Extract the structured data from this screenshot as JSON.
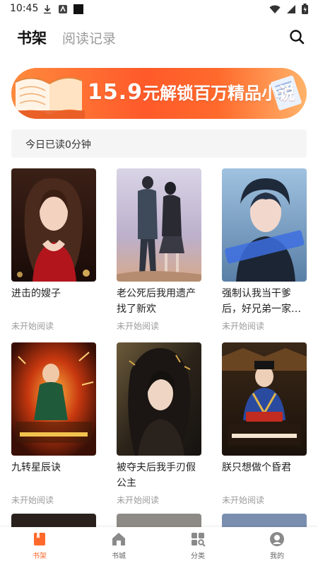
{
  "status_bar": {
    "time": "10:45"
  },
  "header": {
    "tab_active": "书架",
    "tab_inactive": "阅读记录",
    "search_icon": "search-icon"
  },
  "banner": {
    "price": "15.9",
    "text": "元解锁百万精品小说"
  },
  "reading": {
    "text": "今日已读0分钟"
  },
  "books": [
    {
      "title": "进击的嫂子",
      "status": "未开始阅读"
    },
    {
      "title": "老公死后我用遗产找了新欢",
      "status": "未开始阅读"
    },
    {
      "title": "强制认我当干爹后，好兄弟一家…",
      "status": "未开始阅读"
    },
    {
      "title": "九转星辰诀",
      "status": "未开始阅读"
    },
    {
      "title": "被夺夫后我手刃假公主",
      "status": "未开始阅读"
    },
    {
      "title": "朕只想做个昏君",
      "status": "未开始阅读"
    }
  ],
  "bottom_nav": [
    {
      "label": "书架",
      "icon": "bookshelf-icon",
      "active": true
    },
    {
      "label": "书城",
      "icon": "home-icon",
      "active": false
    },
    {
      "label": "分类",
      "icon": "category-icon",
      "active": false
    },
    {
      "label": "我的",
      "icon": "profile-icon",
      "active": false
    }
  ],
  "colors": {
    "accent": "#ff6a2c",
    "muted": "#9c9c9c"
  }
}
